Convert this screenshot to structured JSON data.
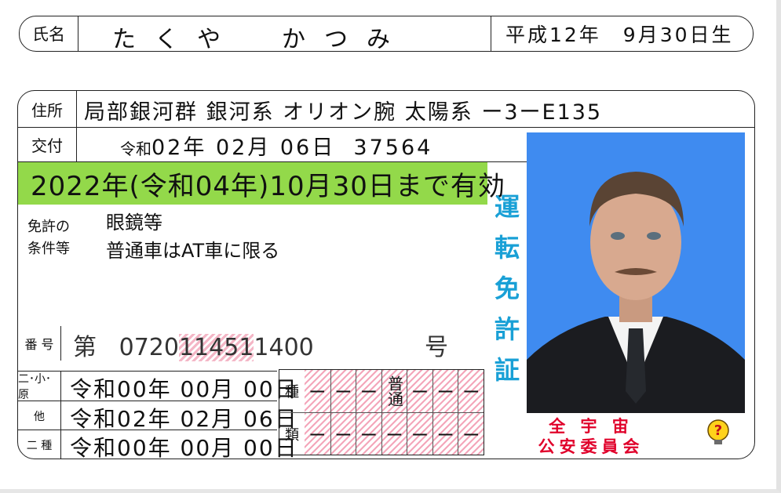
{
  "name_row": {
    "label": "氏名",
    "name": "たくや　かつみ",
    "birth_date": "平成12年　9月30日生"
  },
  "address": {
    "label": "住所",
    "value": "局部銀河群 銀河系 オリオン腕 太陽系 ー3ーE135"
  },
  "issued": {
    "label": "交付",
    "era": "令和",
    "date": "02年 02月 06日",
    "number": "37564"
  },
  "validity": "2022年(令和04年)10月30日まで有効",
  "conditions": {
    "label_line1": "免許の",
    "label_line2": "条件等",
    "line1": "眼鏡等",
    "line2": "普通車はAT車に限る"
  },
  "license_title": [
    "運",
    "転",
    "免",
    "許",
    "証"
  ],
  "license_number": {
    "label": "番 号",
    "prefix": "第",
    "digits_before": "0720",
    "digits_highlight": "11451",
    "digits_after": "1400",
    "suffix": "号"
  },
  "history": [
    {
      "label": "二･小･原",
      "value": "令和00年 00月 00日"
    },
    {
      "label": "他",
      "value": "令和02年 02月 06日"
    },
    {
      "label": "二 種",
      "value": "令和00年 00月 00日"
    }
  ],
  "categories": {
    "label_top": "種",
    "label_bottom": "類",
    "top": [
      "ー",
      "ー",
      "ー",
      "普通",
      "ー",
      "ー",
      "ー"
    ],
    "bottom": [
      "ー",
      "ー",
      "ー",
      "ー",
      "ー",
      "ー",
      "ー"
    ]
  },
  "authority": {
    "line1": "全 宇 宙",
    "line2": "公安委員会"
  },
  "colors": {
    "validity_bg": "#93d94a",
    "photo_bg": "#3f8bf0",
    "title": "#19a0d6",
    "authority": "#e0002a"
  },
  "icons": {
    "hint": "question-bulb-icon"
  }
}
